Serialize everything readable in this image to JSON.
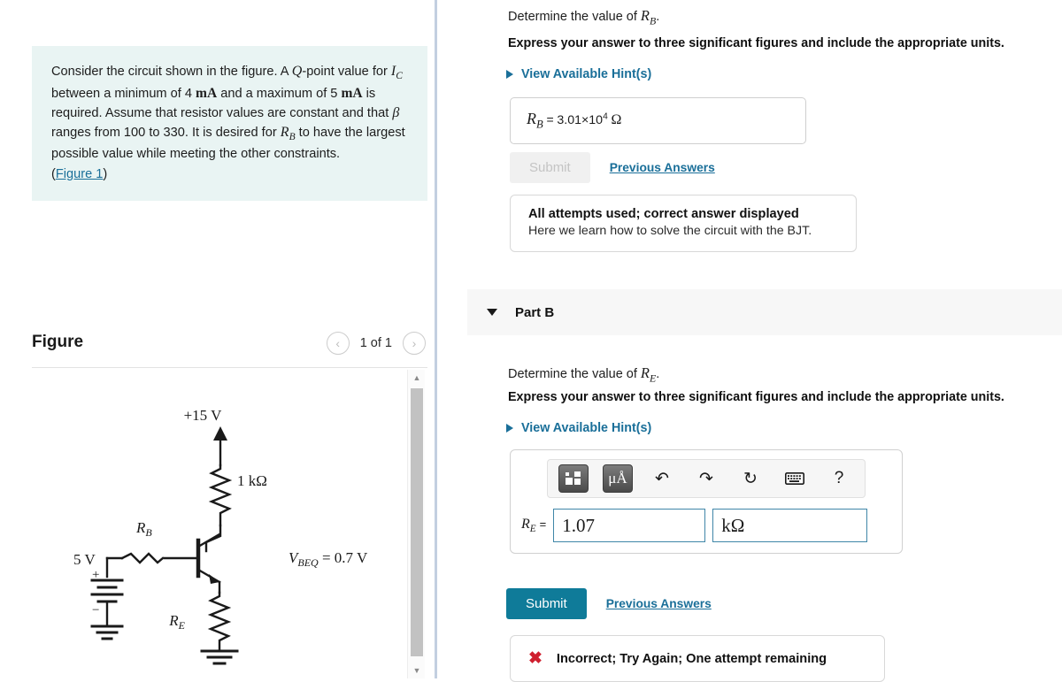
{
  "problem": {
    "text_parts": {
      "p1": "Consider the circuit shown in the figure. A ",
      "q": "Q",
      "p2": "-point value for ",
      "ic": "I",
      "ic_sub": "C",
      "p3": " between a minimum of 4 ",
      "ma1": "mA",
      "p4": " and a maximum of 5 ",
      "ma2": "mA",
      "p5": " is required. Assume that resistor values are constant and that ",
      "beta": "β",
      "p6": " ranges from 100 to 330. It is desired for ",
      "rb": "R",
      "rb_sub": "B",
      "p7": " to have the largest possible value while meeting the other constraints."
    },
    "figure_link": "Figure 1",
    "figure_link_open": "(",
    "figure_link_close": ")"
  },
  "figure": {
    "title": "Figure",
    "counter": "1 of 1",
    "prev_icon": "‹",
    "next_icon": "›",
    "circuit": {
      "supply_label": "+15 V",
      "collector_resistor": "1 kΩ",
      "base_resistor": "R",
      "base_resistor_sub": "B",
      "emitter_resistor": "R",
      "emitter_resistor_sub": "E",
      "vbeq": "V",
      "vbeq_sub": "BEQ",
      "vbeq_value": " = 0.7 V",
      "battery_label": "5 V",
      "battery_plus": "+",
      "battery_minus": "−"
    },
    "scrollbar": {
      "up": "▲",
      "down": "▼"
    }
  },
  "part_a": {
    "question_pre": "Determine the value of ",
    "question_sym": "R",
    "question_sub": "B",
    "question_post": ".",
    "instruction": "Express your answer to three significant figures and include the appropriate units.",
    "hints_label": "View Available Hint(s)",
    "answer": {
      "label_sym": "R",
      "label_sub": "B",
      "equals": "=",
      "mantissa": "3.01×10",
      "exponent": "4",
      "unit": "Ω"
    },
    "submit_label": "Submit",
    "previous_answers_label": "Previous Answers",
    "feedback_title": "All attempts used; correct answer displayed",
    "feedback_sub": "Here we learn how to solve the circuit with the BJT."
  },
  "part_b": {
    "band_label": "Part B",
    "question_pre": "Determine the value of ",
    "question_sym": "R",
    "question_sub": "E",
    "question_post": ".",
    "instruction": "Express your answer to three significant figures and include the appropriate units.",
    "hints_label": "View Available Hint(s)",
    "toolbar": {
      "template_icon": "template-icon",
      "units_label": "μÅ",
      "undo_icon": "↶",
      "redo_icon": "↷",
      "reset_icon": "↻",
      "keyboard_icon": "keyboard-icon",
      "help_label": "?"
    },
    "answer": {
      "label_sym": "R",
      "label_sub": "E",
      "equals": "=",
      "value": "1.07",
      "unit": "kΩ"
    },
    "submit_label": "Submit",
    "previous_answers_label": "Previous Answers",
    "error_mark": "✖",
    "error_text": "Incorrect; Try Again; One attempt remaining"
  },
  "colors": {
    "problem_bg": "#e9f4f3",
    "link": "#1a6f99",
    "submit_active": "#0f7b99",
    "divider": "#c3cfe0",
    "error": "#cf1f2e",
    "band_bg": "#f7f7f7"
  }
}
